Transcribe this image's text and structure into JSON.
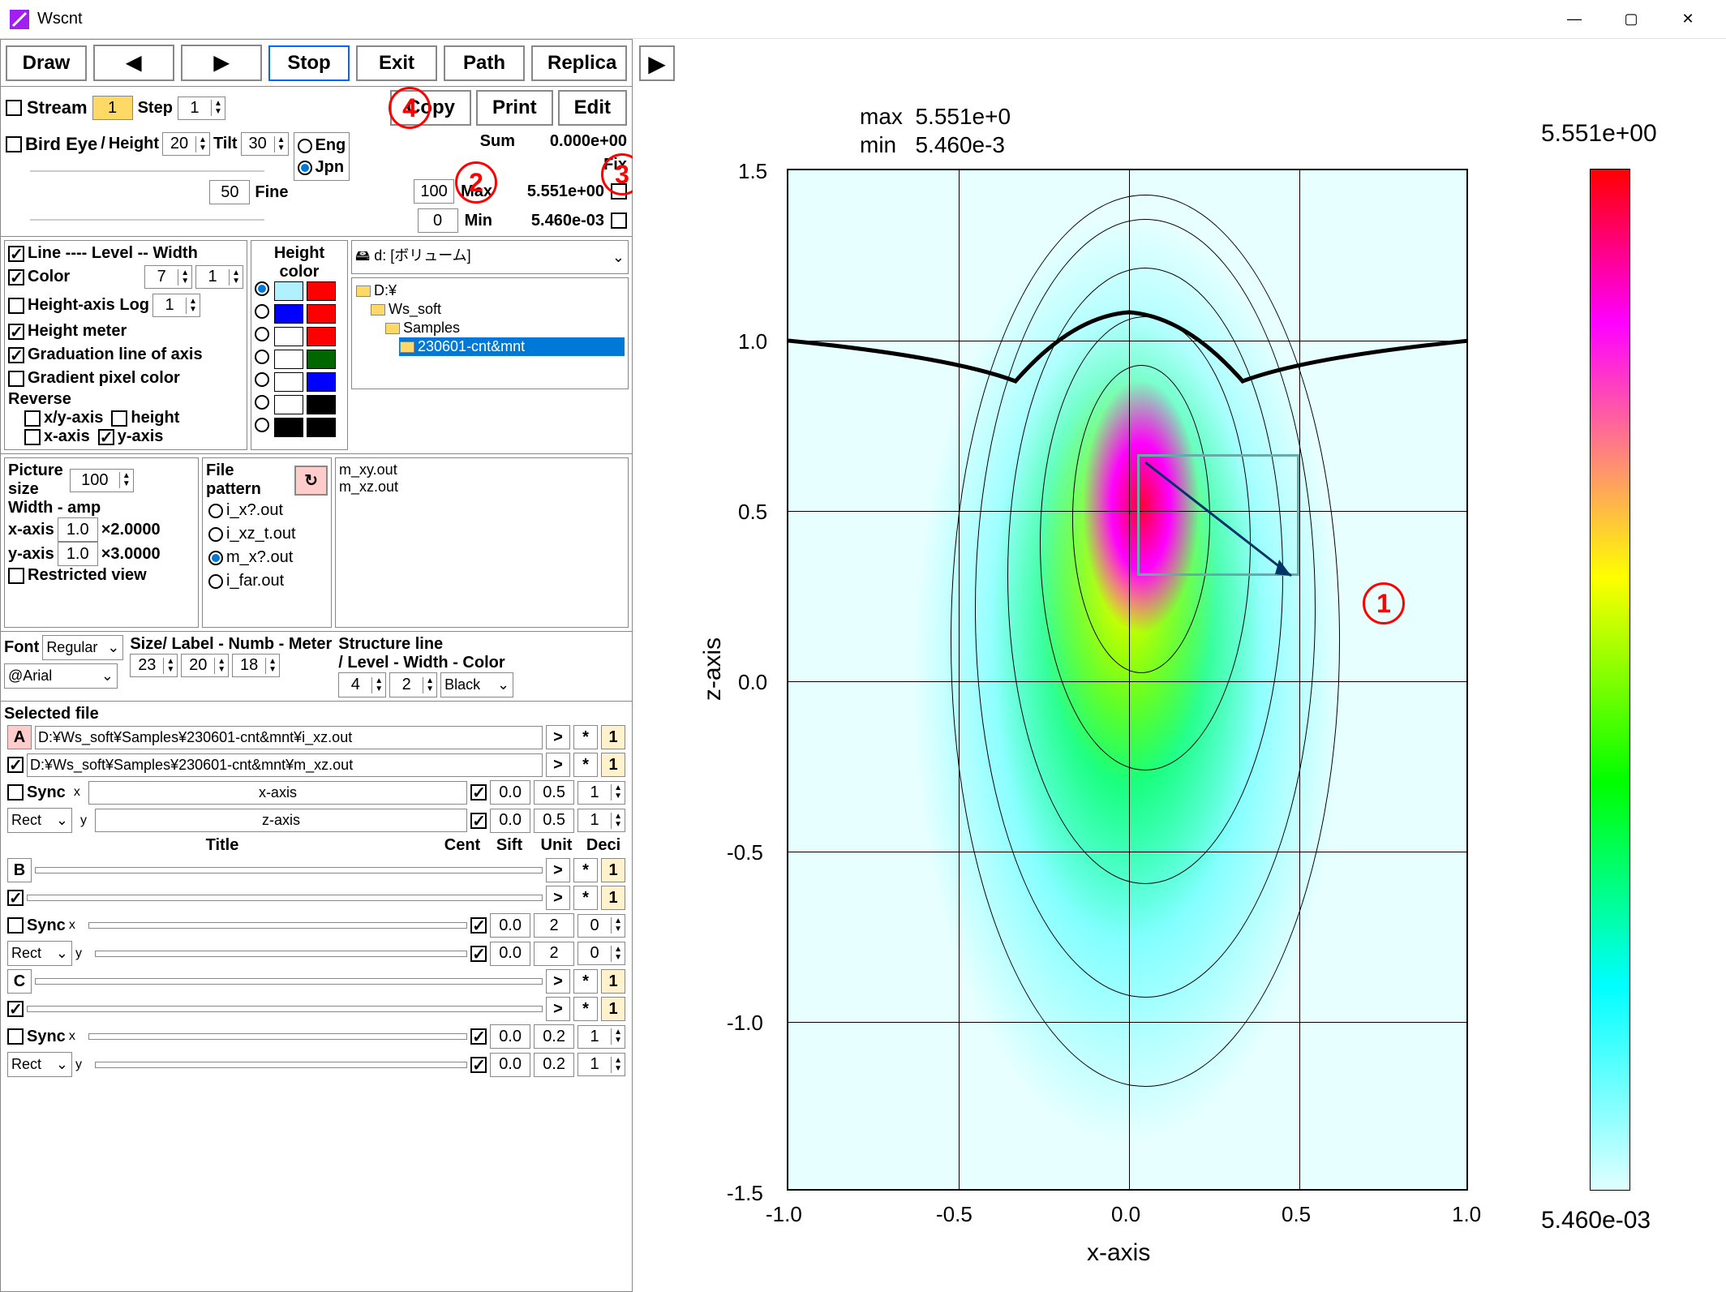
{
  "window": {
    "title": "Wscnt"
  },
  "toolbar1": {
    "draw": "Draw",
    "stop": "Stop",
    "exit": "Exit",
    "path": "Path",
    "replica": "Replica"
  },
  "toolbar2": {
    "stream_label": "Stream",
    "stream_val": "1",
    "step_label": "Step",
    "step_val": "1",
    "copy": "Copy",
    "print": "Print",
    "edit": "Edit"
  },
  "birdeye": {
    "label": "Bird Eye",
    "height_label": "Height",
    "height_val": "20",
    "tilt_label": "Tilt",
    "tilt_val": "30",
    "eng": "Eng",
    "jpn": "Jpn",
    "fine_label": "Fine",
    "fine_val": "50",
    "sum_label": "Sum",
    "sum_val": "0.000e+00",
    "max_label": "Max",
    "max_val": "5.551e+00",
    "max_scale": "100",
    "min_label": "Min",
    "min_val": "5.460e-03",
    "min_scale": "0",
    "fix_label": "Fix"
  },
  "display": {
    "line_label": "Line ---- Level -- Width",
    "line_level": "7",
    "line_width": "1",
    "color_label": "Color",
    "height_log_label": "Height-axis Log",
    "height_log_val": "1",
    "height_meter_label": "Height meter",
    "grad_line_label": "Graduation line of axis",
    "grad_pixel_label": "Gradient pixel color",
    "reverse_label": "Reverse",
    "xy_label": "x/y-axis",
    "h_label": "height",
    "x_label": "x-axis",
    "y_label": "y-axis"
  },
  "height_color": {
    "title": "Height\ncolor"
  },
  "drive": {
    "label": "d: [ボリューム]"
  },
  "tree": {
    "root": "D:¥",
    "ws": "Ws_soft",
    "samples": "Samples",
    "sel": "230601-cnt&mnt"
  },
  "filepattern": {
    "title": "File\npattern",
    "p1": "i_x?.out",
    "p2": "i_xz_t.out",
    "p3": "m_x?.out",
    "p4": "i_far.out"
  },
  "files": {
    "f1": "m_xy.out",
    "f2": "m_xz.out"
  },
  "picsize": {
    "title": "Picture\nsize",
    "val": "100",
    "widthamp": "Width - amp",
    "xaxis_label": "x-axis",
    "xaxis_v1": "1.0",
    "xaxis_v2": "×2.0000",
    "yaxis_label": "y-axis",
    "yaxis_v1": "1.0",
    "yaxis_v2": "×3.0000",
    "restricted": "Restricted view"
  },
  "font": {
    "label": "Font",
    "style": "Regular",
    "family": "@Arial",
    "size_label": "Size/ Label - Numb - Meter",
    "s1": "23",
    "s2": "20",
    "s3": "18",
    "struct_label": "Structure line\n/ Level - Width - Color",
    "level": "4",
    "width": "2",
    "color": "Black"
  },
  "selected": {
    "title": "Selected file",
    "A": {
      "path": "D:¥Ws_soft¥Samples¥230601-cnt&mnt¥i_xz.out",
      "unit": "1"
    },
    "A2": {
      "path": "D:¥Ws_soft¥Samples¥230601-cnt&mnt¥m_xz.out",
      "unit": "1"
    },
    "sync": "Sync",
    "rect": "Rect",
    "ax": {
      "x": "x",
      "xname": "x-axis",
      "xcent": "0.0",
      "xsift": "0.5",
      "xunit": "1",
      "y": "y",
      "yname": "z-axis",
      "ycent": "0.0",
      "ysift": "0.5",
      "yunit": "1"
    },
    "hdr": {
      "title": "Title",
      "cent": "Cent",
      "sift": "Sift",
      "unit": "Unit",
      "deci": "Deci"
    },
    "B": {
      "label": "B",
      "unit": "1",
      "xcent": "0.0",
      "xsift": "2",
      "xunit": "0",
      "ycent": "0.0",
      "ysift": "2",
      "yunit": "0"
    },
    "C": {
      "label": "C",
      "unit": "1",
      "xcent": "0.0",
      "xsift": "0.2",
      "xunit": "1",
      "ycent": "0.0",
      "ysift": "0.2",
      "yunit": "1"
    }
  },
  "callouts": {
    "c1": "1",
    "c2": "2",
    "c3": "3",
    "c4": "4"
  },
  "plot": {
    "max_label": "max",
    "max_val": "5.551e+0",
    "min_label": "min",
    "min_val": "5.460e-3",
    "xaxis": "x-axis",
    "zaxis": "z-axis",
    "cbar_top": "5.551e+00",
    "cbar_bot": "5.460e-03",
    "xticks": [
      "-1.0",
      "-0.5",
      "0.0",
      "0.5",
      "1.0"
    ],
    "yticks": [
      "1.5",
      "1.0",
      "0.5",
      "0.0",
      "-0.5",
      "-1.0",
      "-1.5"
    ]
  },
  "chart_data": {
    "type": "heatmap",
    "title": "",
    "xlabel": "x-axis",
    "ylabel": "z-axis",
    "xlim": [
      -1.0,
      1.0
    ],
    "ylim": [
      -1.5,
      1.5
    ],
    "value_range": [
      0.00546,
      5.551
    ],
    "peak": {
      "x": 0.05,
      "z": 0.5,
      "value": 5.551
    },
    "contour_levels": 7,
    "overlay_curve": {
      "description": "black structure line",
      "approx_level": 1.0
    },
    "colormap": [
      "#e0ffff",
      "#00ffff",
      "#00ff00",
      "#ffff00",
      "#ff00ff",
      "#ff0000"
    ],
    "note": "Gaussian-like intensity distribution centered near (0.05, 0.5), elongated along z; contours and structure overlay rendered on top."
  }
}
